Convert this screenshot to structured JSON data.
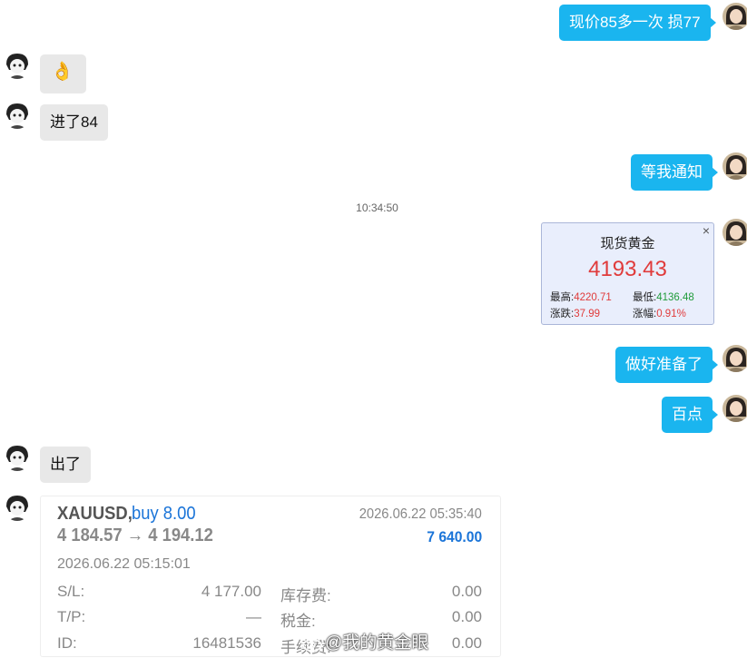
{
  "messages": {
    "m1": "现价85多一次 损77",
    "m2_emoji": "👌",
    "m3": "进了84",
    "m4": "等我通知",
    "timestamp": "10:34:50",
    "m6": "做好准备了",
    "m7": "百点",
    "m8": "出了"
  },
  "quote": {
    "title": "现货黄金",
    "price": "4193.43",
    "high_label": "最高:",
    "high": "4220.71",
    "low_label": "最低:",
    "low": "4136.48",
    "change_label": "涨跌:",
    "change": "37.99",
    "pct_label": "涨幅:",
    "pct": "0.91%",
    "close_glyph": "×"
  },
  "trade": {
    "symbol": "XAUUSD,",
    "side": "buy 8.00",
    "close_time": "2026.06.22 05:35:40",
    "prices": "4 184.57 → 4 194.12",
    "profit": "7 640.00",
    "open_time": "2026.06.22 05:15:01",
    "sl_label": "S/L:",
    "sl": "4 177.00",
    "tp_label": "T/P:",
    "tp": "—",
    "id_label": "ID:",
    "id": "16481536",
    "swap_label": "库存费:",
    "swap": "0.00",
    "tax_label": "税金:",
    "tax": "0.00",
    "fee_label": "手续费:",
    "fee": "0.00"
  },
  "watermark": "@我的黄金眼",
  "colors": {
    "bubble_right": "#1ab5ef",
    "bubble_left": "#e8e8e8",
    "price_red": "#e03b3b",
    "price_green": "#1f9b3a",
    "trade_blue": "#1a74d8"
  }
}
